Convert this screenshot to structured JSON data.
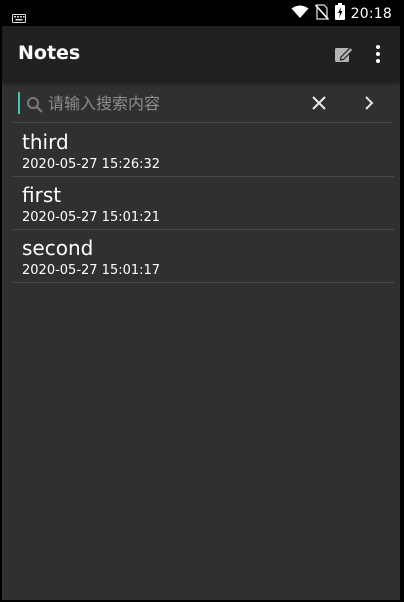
{
  "status_bar": {
    "time": "20:18",
    "icons": [
      "keyboard-icon",
      "wifi-icon",
      "no-sim-icon",
      "battery-icon"
    ]
  },
  "app_bar": {
    "title": "Notes",
    "icons": [
      "compose-icon",
      "more-vert-icon"
    ]
  },
  "search": {
    "placeholder": "请输入搜索内容",
    "value": "",
    "accent_color": "#45c7b5"
  },
  "notes": [
    {
      "title": "third",
      "timestamp": "2020-05-27 15:26:32"
    },
    {
      "title": "first",
      "timestamp": "2020-05-27 15:01:21"
    },
    {
      "title": "second",
      "timestamp": "2020-05-27 15:01:17"
    }
  ],
  "colors": {
    "background": "#303030",
    "app_bar": "#212121",
    "status_bar": "#000000",
    "divider": "#494949"
  }
}
